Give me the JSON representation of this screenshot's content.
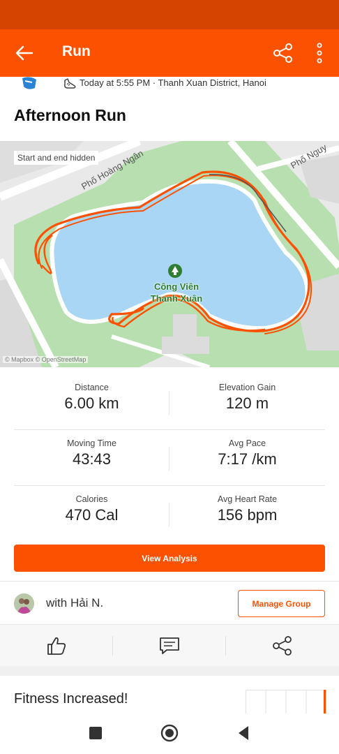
{
  "app_bar": {
    "title": "Run",
    "back_icon": "arrow-left-icon",
    "share_icon": "share-icon",
    "more_icon": "more-vertical-icon"
  },
  "activity": {
    "meta": "Today at 5:55 PM · Thanh Xuan District, Hanoi",
    "title": "Afternoon Run"
  },
  "map": {
    "note": "Start and end hidden",
    "street_1": "Phố Hoàng Ngân",
    "street_2": "Phố Nguy",
    "park_line_1": "Công Viên",
    "park_line_2": "Thanh Xuân",
    "attribution": "© Mapbox © OpenStreetMap"
  },
  "stats": [
    {
      "left_label": "Distance",
      "left_value": "6.00 km",
      "right_label": "Elevation Gain",
      "right_value": "120 m"
    },
    {
      "left_label": "Moving Time",
      "left_value": "43:43",
      "right_label": "Avg Pace",
      "right_value": "7:17 /km"
    },
    {
      "left_label": "Calories",
      "left_value": "470 Cal",
      "right_label": "Avg Heart Rate",
      "right_value": "156 bpm"
    }
  ],
  "buttons": {
    "view_analysis": "View Analysis",
    "manage_group": "Manage Group"
  },
  "group": {
    "text": "with Hải N."
  },
  "actions": {
    "kudos_icon": "thumbs-up-icon",
    "comment_icon": "comment-icon",
    "share_icon": "share-icon"
  },
  "fitness": {
    "title": "Fitness Increased!"
  },
  "colors": {
    "brand": "#fc5200",
    "status_bar": "#d54400"
  }
}
